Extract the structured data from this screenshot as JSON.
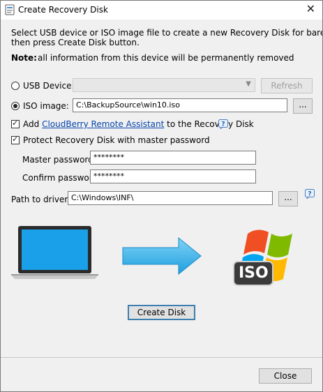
{
  "window": {
    "title": "Create Recovery Disk",
    "close_glyph": "✕"
  },
  "intro": {
    "line1": "Select USB device or ISO image file to create a new Recovery Disk for bare metal restore",
    "line2": "then press Create Disk button.",
    "note_label": "Note:",
    "note_text": "all information from this device will be permanently removed"
  },
  "source": {
    "usb_label": "USB Device:",
    "usb_selected": false,
    "usb_value": "",
    "refresh_label": "Refresh",
    "iso_label": "ISO image:",
    "iso_selected": true,
    "iso_value": "C:\\BackupSource\\win10.iso",
    "browse_label": "..."
  },
  "options": {
    "add_prefix": "Add",
    "add_link": "CloudBerry Remote Assistant",
    "add_suffix": "to the Recovery Disk",
    "add_checked": true,
    "protect_label": "Protect Recovery Disk with master password",
    "protect_checked": true
  },
  "passwords": {
    "master_label": "Master password:",
    "master_value": "********",
    "confirm_label": "Confirm password:",
    "confirm_value": "********"
  },
  "drivers": {
    "label": "Path to drivers:",
    "value": "C:\\Windows\\INF\\",
    "browse_label": "..."
  },
  "illustration": {
    "iso_badge": "ISO"
  },
  "actions": {
    "create_label": "Create Disk",
    "close_label": "Close"
  },
  "icons": {
    "help": "help-icon",
    "laptop": "laptop-icon",
    "arrow": "arrow-right-icon",
    "windows_iso": "windows-iso-icon"
  },
  "colors": {
    "link": "#0645ad",
    "arrow": "#35b6ee",
    "laptop_screen": "#1aa0e8"
  }
}
